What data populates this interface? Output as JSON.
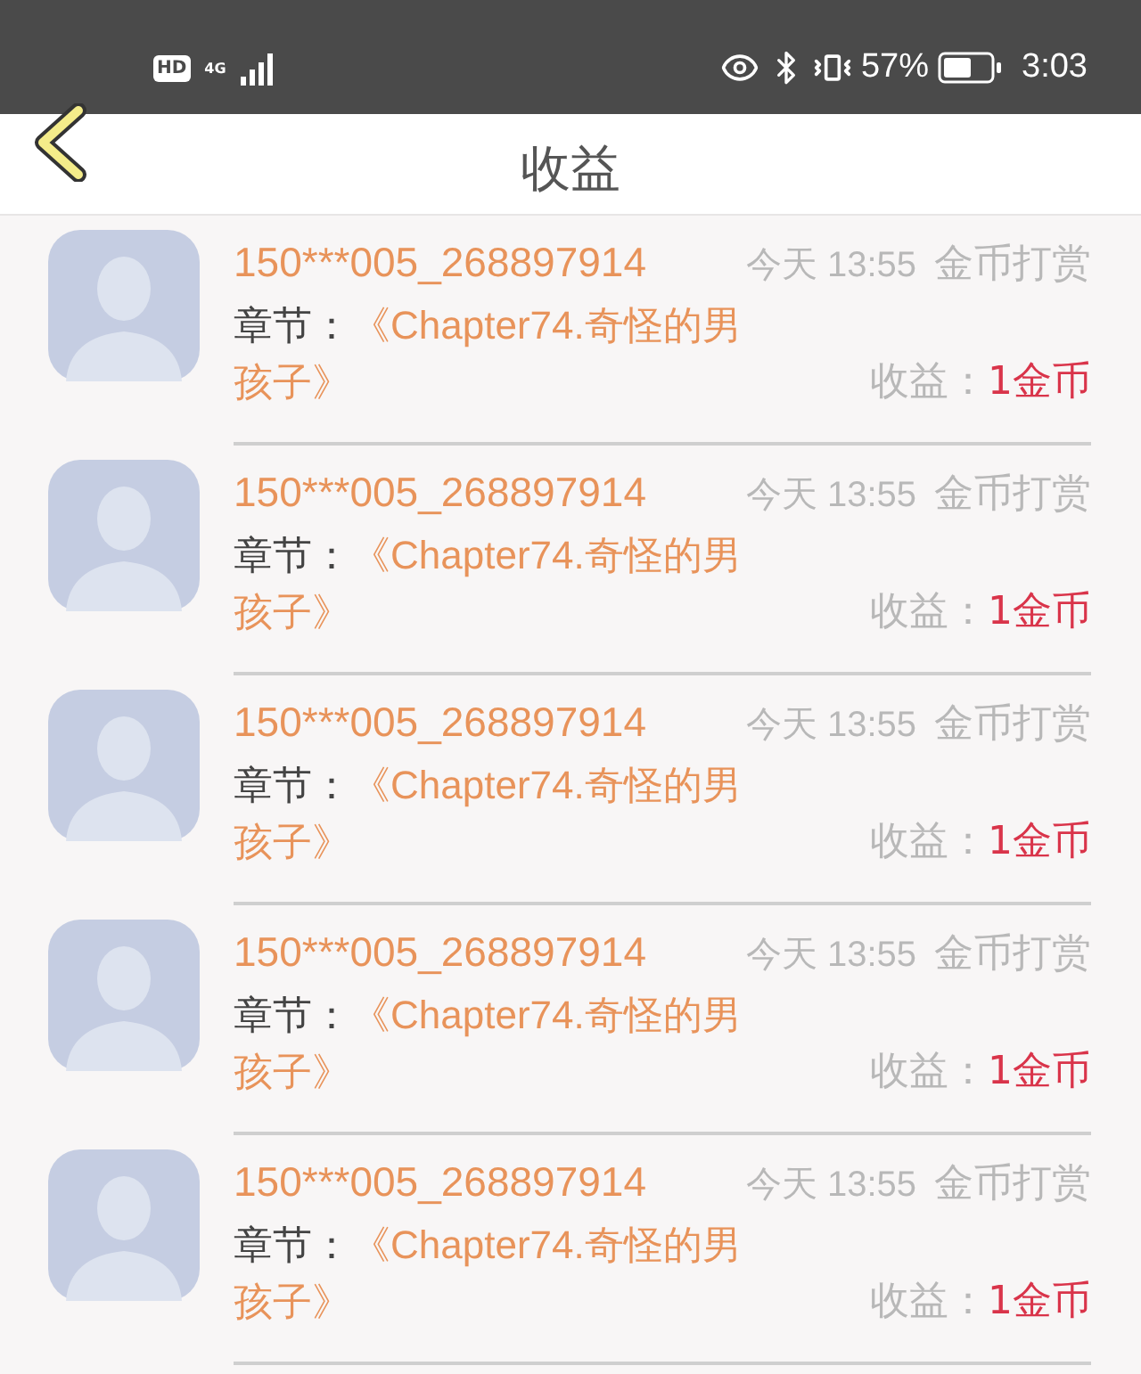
{
  "status_bar": {
    "hd": "HD",
    "network": "4G",
    "battery": "57%",
    "time": "3:03"
  },
  "header": {
    "title": "收益"
  },
  "records": [
    {
      "user": "150***005_268897914",
      "time": "今天 13:55",
      "type": "金币打赏",
      "chapter_label": "章节：",
      "chapter": "《Chapter74.奇怪的男孩子》",
      "earnings_label": "收益：",
      "earnings": "1金币"
    },
    {
      "user": "150***005_268897914",
      "time": "今天 13:55",
      "type": "金币打赏",
      "chapter_label": "章节：",
      "chapter": "《Chapter74.奇怪的男孩子》",
      "earnings_label": "收益：",
      "earnings": "1金币"
    },
    {
      "user": "150***005_268897914",
      "time": "今天 13:55",
      "type": "金币打赏",
      "chapter_label": "章节：",
      "chapter": "《Chapter74.奇怪的男孩子》",
      "earnings_label": "收益：",
      "earnings": "1金币"
    },
    {
      "user": "150***005_268897914",
      "time": "今天 13:55",
      "type": "金币打赏",
      "chapter_label": "章节：",
      "chapter": "《Chapter74.奇怪的男孩子》",
      "earnings_label": "收益：",
      "earnings": "1金币"
    },
    {
      "user": "150***005_268897914",
      "time": "今天 13:55",
      "type": "金币打赏",
      "chapter_label": "章节：",
      "chapter": "《Chapter74.奇怪的男孩子》",
      "earnings_label": "收益：",
      "earnings": "1金币"
    }
  ]
}
